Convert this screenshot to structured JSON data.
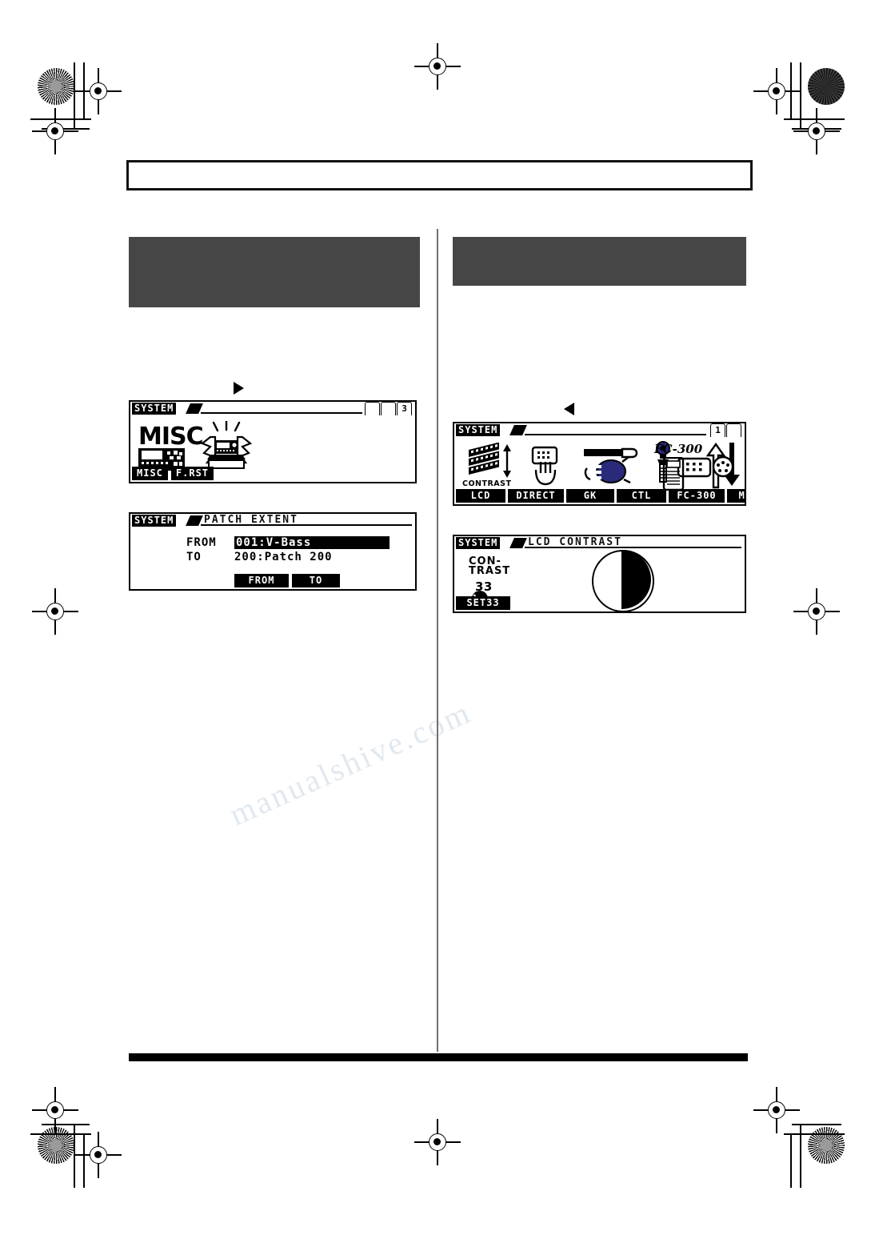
{
  "page": {
    "background": "#ffffff",
    "redaction_color": "#464646",
    "footer_bar_color": "#000000"
  },
  "header": {
    "box_text": ""
  },
  "columns": {
    "left": {
      "heading_redacted": true
    },
    "right": {
      "heading_redacted": true
    }
  },
  "arrows": {
    "left_column_marker": "play-right-triangle",
    "right_column_marker": "play-left-triangle"
  },
  "lcds": [
    {
      "id": "misc-screen",
      "title": "SYSTEM",
      "subtitle": "",
      "pages": [
        {
          "label": "",
          "active": false
        },
        {
          "label": "",
          "active": false
        },
        {
          "label": "3",
          "active": true
        }
      ],
      "big_word": "MISC",
      "icons": [
        {
          "name": "mixer-device-icon",
          "label": ""
        },
        {
          "name": "flashing-device-icon",
          "label": ""
        }
      ],
      "softkeys": [
        {
          "label": "MISC",
          "active": true
        },
        {
          "label": "F.RST",
          "active": true
        }
      ]
    },
    {
      "id": "patch-extent-screen",
      "title": "SYSTEM",
      "subtitle": "PATCH EXTENT",
      "rows": [
        {
          "label": "FROM",
          "value": "001:V-Bass",
          "highlighted": true
        },
        {
          "label": "TO",
          "value": "200:Patch 200",
          "highlighted": false
        }
      ],
      "softkeys": [
        {
          "label": "FROM",
          "active": true
        },
        {
          "label": "TO",
          "active": true
        }
      ]
    },
    {
      "id": "system-menu-screen",
      "title": "SYSTEM",
      "subtitle": "",
      "pages": [
        {
          "label": "1",
          "active": true
        },
        {
          "label": "",
          "active": false
        }
      ],
      "icons": [
        {
          "name": "lcd-contrast-icon",
          "caption": "CONTRAST"
        },
        {
          "name": "direct-hand-icon",
          "caption": ""
        },
        {
          "name": "gk-pickup-icon",
          "caption": ""
        },
        {
          "name": "ctl-pedal-icon",
          "caption": ""
        },
        {
          "name": "fc-300-pedal-icon",
          "caption": "FC-300"
        },
        {
          "name": "midi-arrows-icon",
          "caption": ""
        }
      ],
      "softkeys": [
        {
          "label": "LCD",
          "active": true
        },
        {
          "label": "DIRECT",
          "active": true
        },
        {
          "label": "GK",
          "active": true
        },
        {
          "label": "CTL",
          "active": true
        },
        {
          "label": "FC-300",
          "active": true
        },
        {
          "label": "MIDI",
          "active": true
        }
      ]
    },
    {
      "id": "lcd-contrast-screen",
      "title": "SYSTEM",
      "subtitle": "LCD CONTRAST",
      "param_label_line1": "CON-",
      "param_label_line2": "TRAST",
      "param_value": "33",
      "contrast_percent": 50,
      "softkeys": [
        {
          "label": "SET33",
          "active": true
        }
      ]
    }
  ],
  "watermark": {
    "line1": "manualshive.com",
    "line2": ""
  }
}
